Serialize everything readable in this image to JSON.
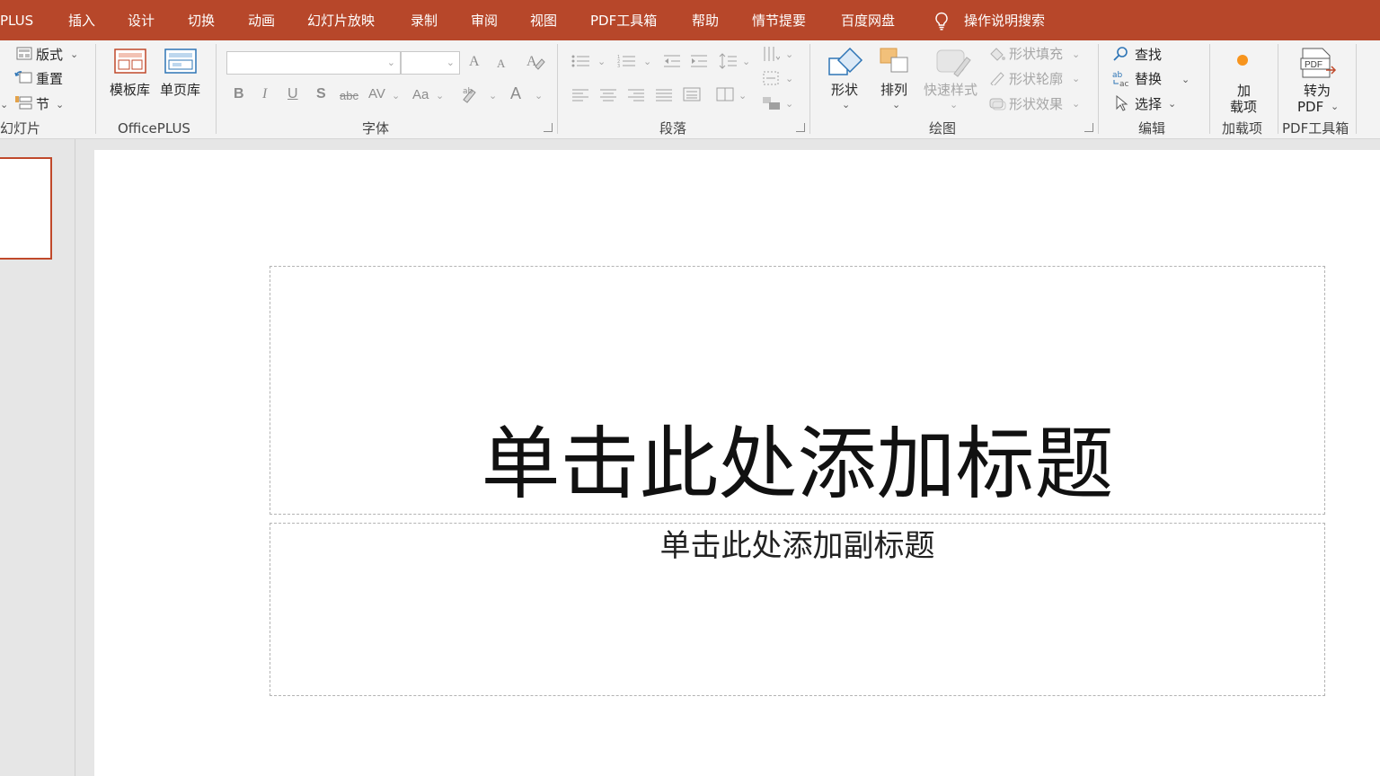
{
  "menu": {
    "items": [
      "PLUS",
      "插入",
      "设计",
      "切换",
      "动画",
      "幻灯片放映",
      "录制",
      "审阅",
      "视图",
      "PDF工具箱",
      "帮助",
      "情节提要",
      "百度网盘"
    ],
    "search_hint": "操作说明搜索"
  },
  "ribbon": {
    "slides": {
      "layout": "版式",
      "reset": "重置",
      "section": "节",
      "group": "幻灯片"
    },
    "officeplus": {
      "templates": "模板库",
      "single_page": "单页库",
      "group": "OfficePLUS"
    },
    "font": {
      "group": "字体",
      "bold": "B",
      "italic": "I",
      "underline": "U",
      "shadow": "S",
      "strike": "abc",
      "spacing": "AV",
      "case": "Aa",
      "font_color": "A",
      "grow": "A",
      "shrink": "A"
    },
    "paragraph": {
      "group": "段落"
    },
    "drawing": {
      "shapes": "形状",
      "arrange": "排列",
      "quick_styles": "快速样式",
      "shape_fill": "形状填充",
      "shape_outline": "形状轮廓",
      "shape_effects": "形状效果",
      "group": "绘图"
    },
    "editing": {
      "find": "查找",
      "replace": "替换",
      "select": "选择",
      "group": "编辑"
    },
    "addins": {
      "label_line1": "加",
      "label_line2": "载项",
      "group": "加载项"
    },
    "pdf": {
      "convert_line1": "转为",
      "convert_line2": "PDF",
      "group": "PDF工具箱",
      "icon_text": "PDF"
    }
  },
  "slide": {
    "title": "单击此处添加标题",
    "subtitle": "单击此处添加副标题"
  },
  "colors": {
    "accent": "#b7472a",
    "thumb_border": "#c0492b"
  }
}
